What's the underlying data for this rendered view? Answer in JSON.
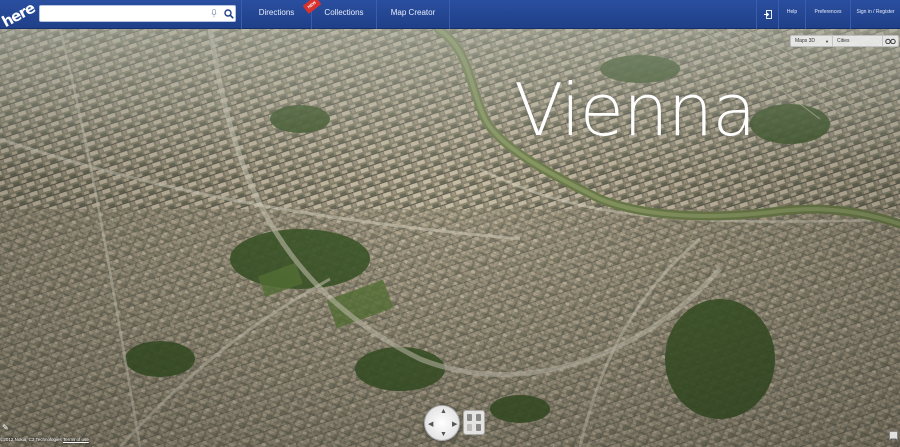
{
  "header": {
    "logo_text": "here",
    "search": {
      "value": "",
      "placeholder": ""
    },
    "nav": [
      {
        "label": "Directions"
      },
      {
        "label": "Collections",
        "badge": "NEW"
      },
      {
        "label": "Map Creator"
      }
    ],
    "right": {
      "help": "Help",
      "preferences": "Preferences",
      "signin": "Sign in / Register"
    }
  },
  "map": {
    "city_label": "Vienna",
    "view_toolbar": {
      "view": "Maps 3D",
      "layer": "Cities"
    },
    "attribution": {
      "copyright": "©2012 Nokia, C3 Technologies",
      "terms": "Terms of use"
    }
  },
  "colors": {
    "header_blue": "#2a4fa0",
    "river": "#7d8a55",
    "badge_red": "#d8322e"
  }
}
